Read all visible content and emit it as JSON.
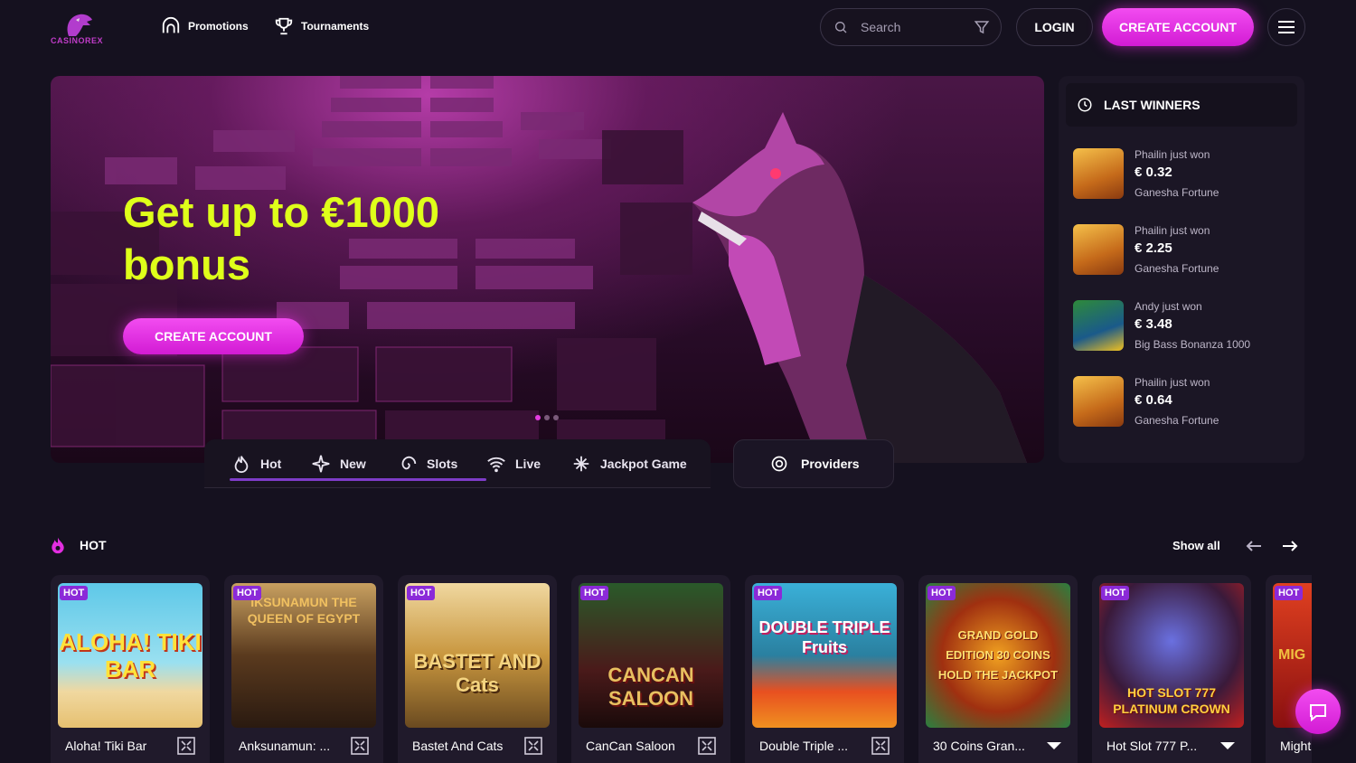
{
  "brand": {
    "name": "CASINOREX",
    "accent": "#e22ee0",
    "highlight": "#dfff1a"
  },
  "nav": [
    {
      "label": "Promotions",
      "icon": "promotions-icon"
    },
    {
      "label": "Tournaments",
      "icon": "trophy-icon"
    }
  ],
  "search": {
    "placeholder": "Search"
  },
  "header": {
    "login_label": "LOGIN",
    "create_label": "CREATE ACCOUNT"
  },
  "hero": {
    "title": "Get up to €1000 bonus",
    "button_label": "CREATE ACCOUNT",
    "active_slide": 1,
    "slide_count": 3
  },
  "categories": [
    {
      "label": "Hot",
      "icon": "flame-icon",
      "active": true
    },
    {
      "label": "New",
      "icon": "sparkle-icon"
    },
    {
      "label": "Slots",
      "icon": "spiral-icon"
    },
    {
      "label": "Live",
      "icon": "wifi-icon"
    },
    {
      "label": "Jackpot Game",
      "icon": "star-burst-icon"
    }
  ],
  "providers_label": "Providers",
  "winners": {
    "title": "LAST WINNERS",
    "items": [
      {
        "who": "Phailin just won",
        "amount": "€ 0.32",
        "game": "Ganesha Fortune"
      },
      {
        "who": "Phailin just won",
        "amount": "€ 2.25",
        "game": "Ganesha Fortune"
      },
      {
        "who": "Andy just won",
        "amount": "€ 3.48",
        "game": "Big Bass Bonanza 1000"
      },
      {
        "who": "Phailin just won",
        "amount": "€ 0.64",
        "game": "Ganesha Fortune"
      }
    ]
  },
  "hot": {
    "title": "HOT",
    "show_all": "Show all",
    "badge": "HOT",
    "games": [
      {
        "name": "Aloha! Tiki Bar",
        "art_text": "ALOHA! TIKI BAR"
      },
      {
        "name": "Anksunamun: ...",
        "art_text": "IKSUNAMUN THE QUEEN OF EGYPT"
      },
      {
        "name": "Bastet And Cats",
        "art_text": "BASTET AND Cats"
      },
      {
        "name": "CanCan Saloon",
        "art_text": "CANCAN SALOON"
      },
      {
        "name": "Double Triple ...",
        "art_text": "DOUBLE TRIPLE Fruits"
      },
      {
        "name": "30 Coins Gran...",
        "art_text": "GRAND GOLD EDITION 30 COINS HOLD THE JACKPOT"
      },
      {
        "name": "Hot Slot 777 P...",
        "art_text": "HOT SLOT 777 PLATINUM CROWN"
      },
      {
        "name": "Might",
        "art_text": "MIG"
      }
    ]
  }
}
